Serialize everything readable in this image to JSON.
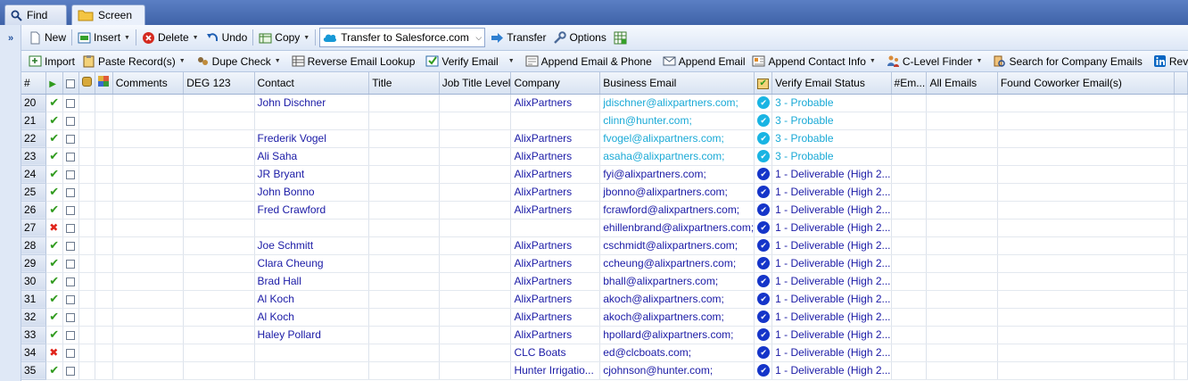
{
  "tabs": [
    {
      "label": "Find",
      "icon": "search-icon"
    },
    {
      "label": "Screen",
      "icon": "folder-icon"
    }
  ],
  "toolbar1": {
    "new": "New",
    "insert": "Insert",
    "delete": "Delete",
    "undo": "Undo",
    "copy": "Copy",
    "target_select": "Transfer to Salesforce.com",
    "transfer": "Transfer",
    "options": "Options"
  },
  "toolbar2": {
    "import": "Import",
    "paste": "Paste Record(s)",
    "dupe": "Dupe Check",
    "reverse_lookup": "Reverse Email Lookup",
    "verify": "Verify Email",
    "append_email_phone": "Append Email & Phone",
    "append_email": "Append Email",
    "append_contact": "Append Contact Info",
    "clevel": "C-Level Finder",
    "search_company": "Search for Company Emails",
    "reverse": "Reverse"
  },
  "columns": {
    "num": "#",
    "comments": "Comments",
    "deg": "DEG 123",
    "contact": "Contact",
    "title": "Title",
    "job_level": "Job Title Level",
    "company": "Company",
    "email": "Business Email",
    "verify_status": "Verify Email Status",
    "em_count": "#Em...",
    "all_emails": "All Emails",
    "coworker": "Found Coworker Email(s)"
  },
  "colors": {
    "probable": "#19a9d6",
    "deliverable_icon": "#1535c9",
    "link_text": "#1a1aa6"
  },
  "rows": [
    {
      "num": "20",
      "flag": "ok",
      "contact": "John Dischner",
      "company": "AlixPartners",
      "email": "jdischner@alixpartners.com;",
      "status": "3 - Probable",
      "level": "probable"
    },
    {
      "num": "21",
      "flag": "ok",
      "contact": "",
      "company": "",
      "email": "clinn@hunter.com;",
      "status": "3 - Probable",
      "level": "probable"
    },
    {
      "num": "22",
      "flag": "ok",
      "contact": "Frederik Vogel",
      "company": "AlixPartners",
      "email": "fvogel@alixpartners.com;",
      "status": "3 - Probable",
      "level": "probable"
    },
    {
      "num": "23",
      "flag": "ok",
      "contact": "Ali Saha",
      "company": "AlixPartners",
      "email": "asaha@alixpartners.com;",
      "status": "3 - Probable",
      "level": "probable"
    },
    {
      "num": "24",
      "flag": "ok",
      "contact": "JR Bryant",
      "company": "AlixPartners",
      "email": "fyi@alixpartners.com;",
      "status": "1 - Deliverable (High 2...",
      "level": "deliverable"
    },
    {
      "num": "25",
      "flag": "ok",
      "contact": "John Bonno",
      "company": "AlixPartners",
      "email": "jbonno@alixpartners.com;",
      "status": "1 - Deliverable (High 2...",
      "level": "deliverable"
    },
    {
      "num": "26",
      "flag": "ok",
      "contact": "Fred Crawford",
      "company": "AlixPartners",
      "email": "fcrawford@alixpartners.com;",
      "status": "1 - Deliverable (High 2...",
      "level": "deliverable"
    },
    {
      "num": "27",
      "flag": "bad",
      "contact": "",
      "company": "",
      "email": "ehillenbrand@alixpartners.com;",
      "status": "1 - Deliverable (High 2...",
      "level": "deliverable"
    },
    {
      "num": "28",
      "flag": "ok",
      "contact": "Joe Schmitt",
      "company": "AlixPartners",
      "email": "cschmidt@alixpartners.com;",
      "status": "1 - Deliverable (High 2...",
      "level": "deliverable"
    },
    {
      "num": "29",
      "flag": "ok",
      "contact": "Clara Cheung",
      "company": "AlixPartners",
      "email": "ccheung@alixpartners.com;",
      "status": "1 - Deliverable (High 2...",
      "level": "deliverable"
    },
    {
      "num": "30",
      "flag": "ok",
      "contact": "Brad Hall",
      "company": "AlixPartners",
      "email": "bhall@alixpartners.com;",
      "status": "1 - Deliverable (High 2...",
      "level": "deliverable"
    },
    {
      "num": "31",
      "flag": "ok",
      "contact": "Al Koch",
      "company": "AlixPartners",
      "email": "akoch@alixpartners.com;",
      "status": "1 - Deliverable (High 2...",
      "level": "deliverable"
    },
    {
      "num": "32",
      "flag": "ok",
      "contact": "Al Koch",
      "company": "AlixPartners",
      "email": "akoch@alixpartners.com;",
      "status": "1 - Deliverable (High 2...",
      "level": "deliverable"
    },
    {
      "num": "33",
      "flag": "ok",
      "contact": "Haley Pollard",
      "company": "AlixPartners",
      "email": "hpollard@alixpartners.com;",
      "status": "1 - Deliverable (High 2...",
      "level": "deliverable"
    },
    {
      "num": "34",
      "flag": "bad",
      "contact": "",
      "company": "CLC Boats",
      "email": "ed@clcboats.com;",
      "status": "1 - Deliverable (High 2...",
      "level": "deliverable"
    },
    {
      "num": "35",
      "flag": "ok",
      "contact": "",
      "company": "Hunter Irrigatio...",
      "email": "cjohnson@hunter.com;",
      "status": "1 - Deliverable (High 2...",
      "level": "deliverable"
    }
  ]
}
